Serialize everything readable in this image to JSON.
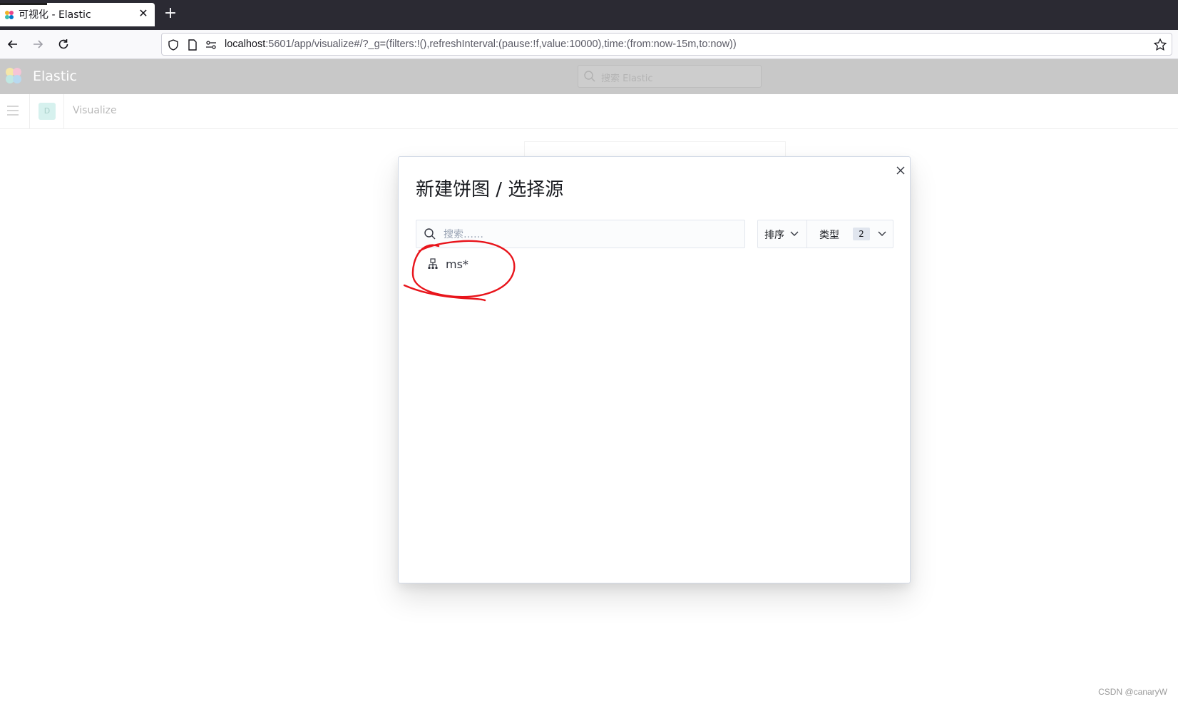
{
  "browser": {
    "tab": {
      "title": "可视化 - Elastic"
    },
    "url": {
      "host": "localhost",
      "path": ":5601/app/visualize#/?_g=(filters:!(),refreshInterval:(pause:!f,value:10000),time:(from:now-15m,to:now))"
    }
  },
  "kibana": {
    "brand": "Elastic",
    "search_placeholder": "搜索 Elastic",
    "space_initial": "D",
    "breadcrumb": "Visualize"
  },
  "modal": {
    "title": "新建饼图 / 选择源",
    "search_placeholder": "搜索……",
    "sort_label": "排序",
    "type_label": "类型",
    "type_count": "2",
    "results": [
      {
        "label": "ms*",
        "icon": "index-pattern-icon"
      }
    ]
  },
  "annotation": {
    "color": "#e8141b",
    "shape": "hand-drawn circle around ms*"
  },
  "watermark": "CSDN @canaryW"
}
